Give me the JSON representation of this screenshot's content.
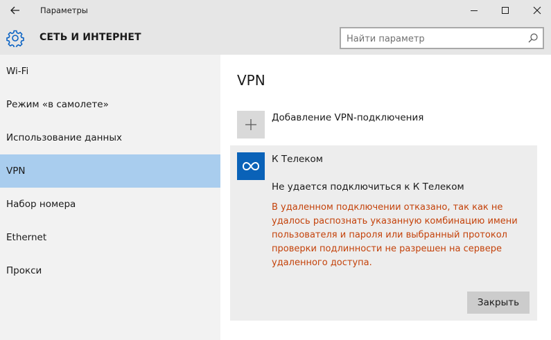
{
  "window": {
    "title": "Параметры",
    "back_icon": "back-arrow-icon",
    "controls": [
      "minimize-icon",
      "maximize-icon",
      "close-icon"
    ]
  },
  "header": {
    "icon": "gear-icon",
    "title": "СЕТЬ И ИНТЕРНЕТ",
    "search": {
      "placeholder": "Найти параметр",
      "value": "",
      "icon": "search-icon"
    }
  },
  "sidebar": {
    "items": [
      {
        "label": "Wi-Fi",
        "selected": false
      },
      {
        "label": "Режим «в самолете»",
        "selected": false
      },
      {
        "label": "Использование данных",
        "selected": false
      },
      {
        "label": "VPN",
        "selected": true
      },
      {
        "label": "Набор номера",
        "selected": false
      },
      {
        "label": "Ethernet",
        "selected": false
      },
      {
        "label": "Прокси",
        "selected": false
      }
    ]
  },
  "main": {
    "title": "VPN",
    "add_vpn": {
      "icon": "plus-icon",
      "label": "Добавление VPN-подключения"
    },
    "connection": {
      "icon": "vpn-connection-icon",
      "name": "К Телеком",
      "status": "Не удается подключиться к К Телеком",
      "error_lines": [
        "В удаленном подключении отказано, так как не",
        "удалось распознать указанную комбинацию имени",
        "пользователя и пароля или выбранный протокол",
        "проверки подлинности не разрешен на сервере",
        "удаленного доступа."
      ],
      "close_label": "Закрыть"
    }
  },
  "colors": {
    "chrome_bg": "#e6e6e6",
    "sidebar_bg": "#f2f2f2",
    "selected_bg": "#a9cdee",
    "card_bg": "#ededed",
    "logo_bg": "#0a62b8",
    "error_text": "#c4420a",
    "button_bg": "#cccccc"
  }
}
